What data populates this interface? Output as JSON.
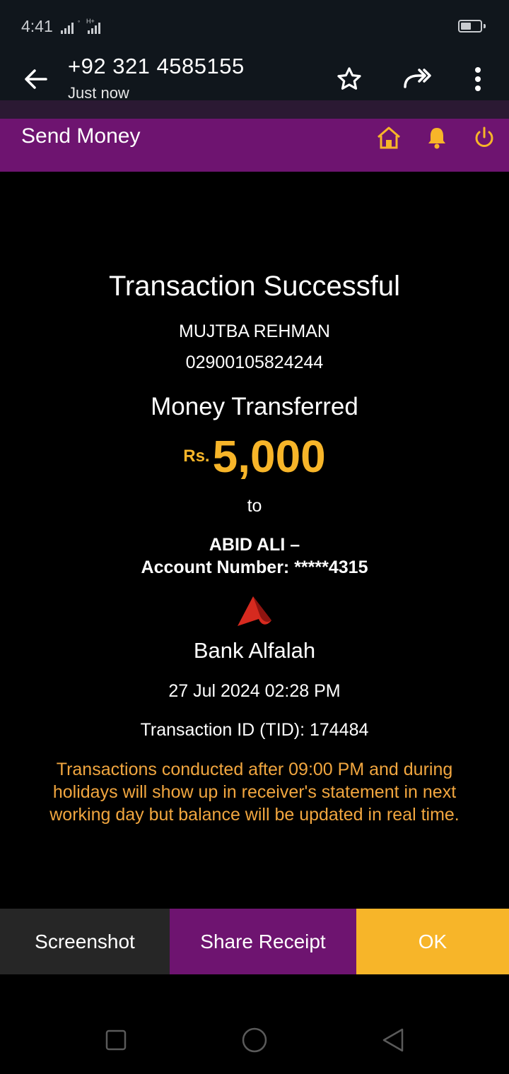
{
  "status_bar": {
    "time": "4:41",
    "network_label": "H+"
  },
  "viewer": {
    "sender": "+92 321 4585155",
    "time": "Just now",
    "icons": [
      "back-arrow-icon",
      "star-icon",
      "forward-all-icon",
      "more-vert-icon"
    ]
  },
  "app": {
    "title": "Send Money",
    "header_icons": [
      "home-icon",
      "bell-icon",
      "power-icon"
    ],
    "accent": "#6e1470",
    "highlight": "#f7b529"
  },
  "receipt": {
    "heading": "Transaction Successful",
    "sender_name": "MUJTBA REHMAN",
    "sender_account": "02900105824244",
    "label_transferred": "Money Transferred",
    "currency": "Rs.",
    "amount": "5,000",
    "to": "to",
    "receiver": "ABID ALI –",
    "receiver_account": "Account Number: *****4315",
    "bank": "Bank Alfalah",
    "datetime": "27 Jul 2024 02:28 PM",
    "tid": "Transaction ID (TID): 174484",
    "notice": "Transactions conducted after 09:00 PM and during holidays will show up in receiver's statement in next working day but balance will be updated in real time."
  },
  "actions": {
    "screenshot": "Screenshot",
    "share": "Share Receipt",
    "ok": "OK"
  },
  "nav": [
    "recents-square-icon",
    "home-circle-icon",
    "back-triangle-icon"
  ]
}
